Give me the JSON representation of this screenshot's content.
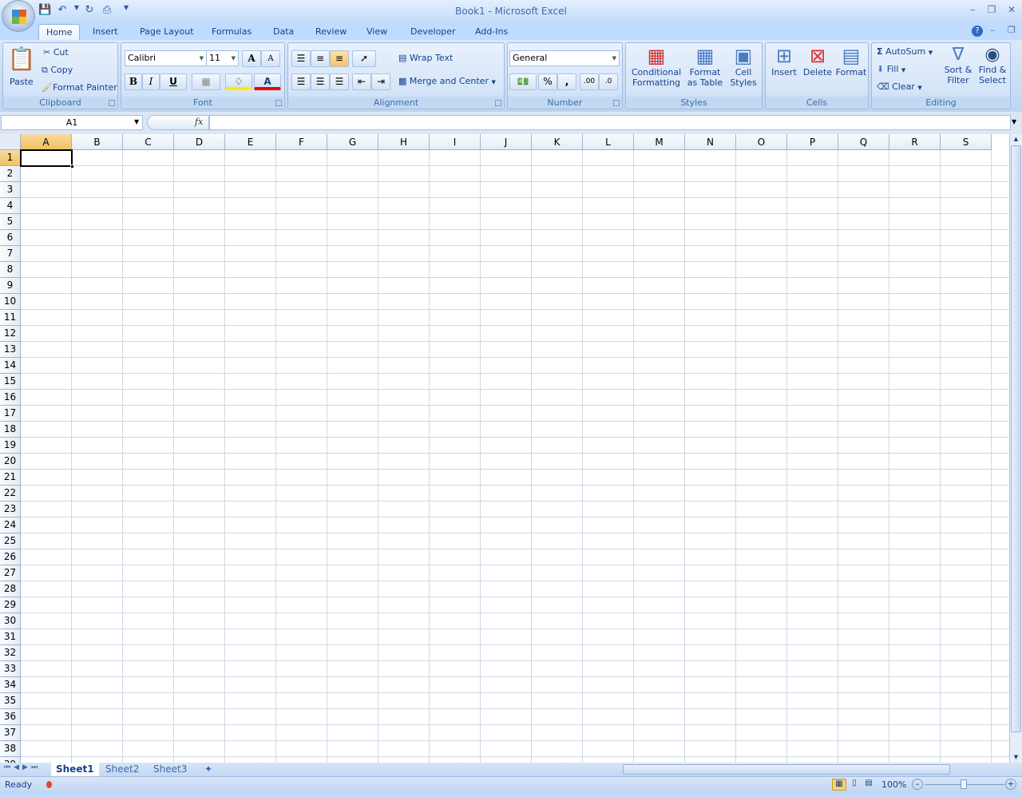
{
  "window": {
    "title": "Book1 - Microsoft Excel"
  },
  "ribbon_tabs": [
    "Home",
    "Insert",
    "Page Layout",
    "Formulas",
    "Data",
    "Review",
    "View",
    "Developer",
    "Add-Ins"
  ],
  "clipboard": {
    "label": "Clipboard",
    "paste": "Paste",
    "cut": "Cut",
    "copy": "Copy",
    "format_painter": "Format Painter"
  },
  "font": {
    "label": "Font",
    "name": "Calibri",
    "size": "11",
    "bold": "B",
    "italic": "I",
    "underline": "U",
    "grow": "A",
    "shrink": "A",
    "font_color": "A"
  },
  "alignment": {
    "label": "Alignment",
    "wrap": "Wrap Text",
    "merge": "Merge and Center"
  },
  "number": {
    "label": "Number",
    "format": "General",
    "percent": "%",
    "comma": ",",
    "inc": ".00",
    "dec": ".0"
  },
  "styles": {
    "label": "Styles",
    "cond1": "Conditional",
    "cond2": "Formatting",
    "fmt1": "Format",
    "fmt2": "as Table",
    "cell1": "Cell",
    "cell2": "Styles"
  },
  "cells": {
    "label": "Cells",
    "insert": "Insert",
    "delete": "Delete",
    "format": "Format"
  },
  "editing": {
    "label": "Editing",
    "autosum": "AutoSum",
    "fill": "Fill",
    "clear": "Clear",
    "sort1": "Sort &",
    "sort2": "Filter",
    "find1": "Find &",
    "find2": "Select"
  },
  "formula_bar": {
    "name_box": "A1",
    "fx": "fx",
    "value": ""
  },
  "grid": {
    "columns": [
      "A",
      "B",
      "C",
      "D",
      "E",
      "F",
      "G",
      "H",
      "I",
      "J",
      "K",
      "L",
      "M",
      "N",
      "O",
      "P",
      "Q",
      "R",
      "S"
    ],
    "rows": 38,
    "active_cell": "A1"
  },
  "sheets": [
    "Sheet1",
    "Sheet2",
    "Sheet3"
  ],
  "active_sheet": "Sheet1",
  "status": {
    "text": "Ready",
    "zoom": "100%"
  }
}
